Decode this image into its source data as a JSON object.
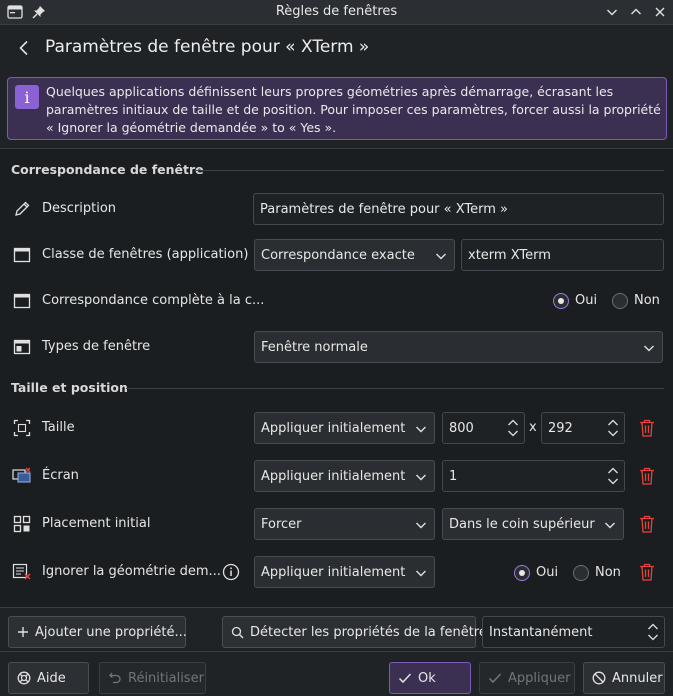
{
  "window": {
    "title": "Règles de fenêtres"
  },
  "header": {
    "title": "Paramètres de fenêtre pour « XTerm »"
  },
  "banner": {
    "text": "Quelques applications définissent leurs propres géométries après démarrage, écrasant les paramètres initiaux de taille et de position. Pour imposer ces paramètres, forcer aussi la propriété « Ignorer la géométrie demandée » to « Yes »."
  },
  "sections": {
    "matching": "Correspondance de fenêtre",
    "size": "Taille et position"
  },
  "rows": {
    "description": {
      "label": "Description",
      "value": "Paramètres de fenêtre pour « XTerm »"
    },
    "window_class": {
      "label": "Classe de fenêtres (application)",
      "match": "Correspondance exacte",
      "value": "xterm XTerm"
    },
    "whole_class": {
      "label": "Correspondance complète à la c...",
      "yes": "Oui",
      "no": "Non",
      "selected": "Oui"
    },
    "window_types": {
      "label": "Types de fenêtre",
      "value": "Fenêtre normale"
    },
    "size": {
      "label": "Taille",
      "policy": "Appliquer initialement",
      "width": "800",
      "separator": "x",
      "height": "292"
    },
    "screen": {
      "label": "Écran",
      "policy": "Appliquer initialement",
      "value": "1"
    },
    "placement": {
      "label": "Placement initial",
      "policy": "Forcer",
      "value": "Dans le coin supérieur ga"
    },
    "ignore_geometry": {
      "label": "Ignorer la géométrie dem...",
      "policy": "Appliquer initialement",
      "yes": "Oui",
      "no": "Non",
      "selected": "Oui"
    }
  },
  "toolbar": {
    "add_property": "Ajouter une propriété...",
    "detect": "Détecter les propriétés de la fenêtre",
    "detect_delay": "Instantanément"
  },
  "footer": {
    "help": "Aide",
    "reset": "Réinitialiser",
    "ok": "Ok",
    "apply": "Appliquer",
    "cancel": "Annuler"
  },
  "colors": {
    "accent": "#8b62d4",
    "delete": "#e0443e"
  }
}
